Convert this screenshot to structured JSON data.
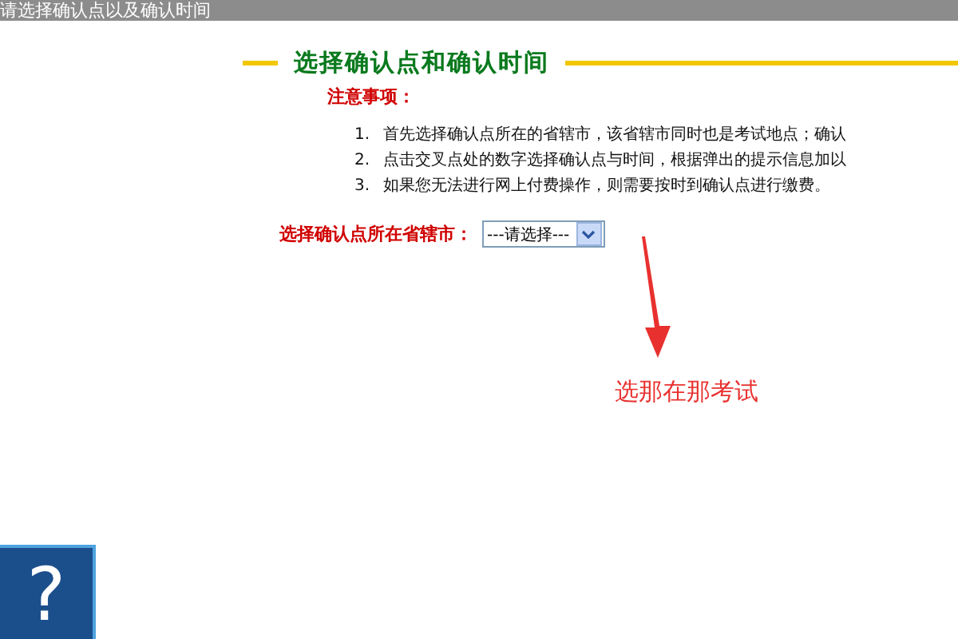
{
  "title_bar": {
    "title": "请选择确认点以及确认时间"
  },
  "section": {
    "heading": "选择确认点和确认时间",
    "notes_title": "注意事项：",
    "notes": [
      {
        "number": "1.",
        "text": "首先选择确认点所在的省辖市，该省辖市同时也是考试地点；确认"
      },
      {
        "number": "2.",
        "text": "点击交叉点处的数字选择确认点与时间，根据弹出的提示信息加以"
      },
      {
        "number": "3.",
        "text": "如果您无法进行网上付费操作，则需要按时到确认点进行缴费。"
      }
    ]
  },
  "form": {
    "label": "选择确认点所在省辖市：",
    "select": {
      "value": "---请选择---"
    }
  },
  "annotation": {
    "text": "选那在那考试"
  },
  "help_button": {
    "label": "?"
  }
}
